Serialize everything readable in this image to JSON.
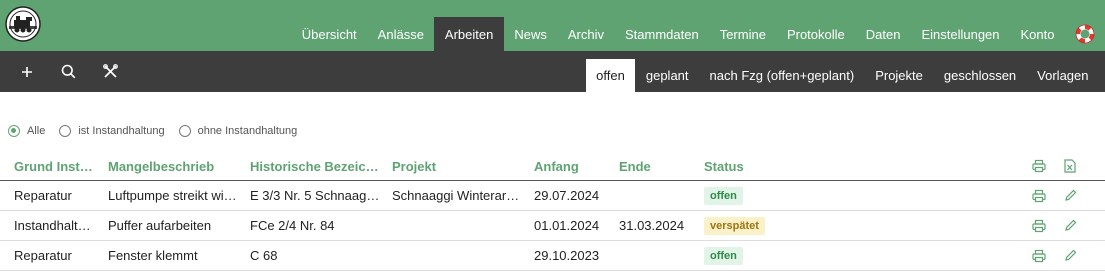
{
  "nav": {
    "items": [
      "Übersicht",
      "Anlässe",
      "Arbeiten",
      "News",
      "Archiv",
      "Stammdaten",
      "Termine",
      "Protokolle",
      "Daten",
      "Einstellungen",
      "Konto"
    ],
    "active": "Arbeiten"
  },
  "subtabs": {
    "items": [
      "offen",
      "geplant",
      "nach Fzg (offen+geplant)",
      "Projekte",
      "geschlossen",
      "Vorlagen"
    ],
    "active": "offen"
  },
  "filters": {
    "options": [
      "Alle",
      "ist Instandhaltung",
      "ohne Instandhaltung"
    ],
    "selected": "Alle"
  },
  "table": {
    "headers": [
      "Grund Inst…",
      "Mangelbeschrieb",
      "Historische Bezeic…",
      "Projekt",
      "Anfang",
      "Ende",
      "Status"
    ],
    "rows": [
      {
        "grund": "Reparatur",
        "mangel": "Luftpumpe streikt wi…",
        "bez": "E 3/3 Nr. 5 Schnaag…",
        "projekt": "Schnaaggi Winterar…",
        "anfang": "29.07.2024",
        "ende": "",
        "status": "offen"
      },
      {
        "grund": "Instandhalt…",
        "mangel": "Puffer aufarbeiten",
        "bez": "FCe 2/4 Nr. 84",
        "projekt": "",
        "anfang": "01.01.2024",
        "ende": "31.03.2024",
        "status": "verspätet"
      },
      {
        "grund": "Reparatur",
        "mangel": "Fenster klemmt",
        "bez": "C 68",
        "projekt": "",
        "anfang": "29.10.2023",
        "ende": "",
        "status": "offen"
      }
    ]
  },
  "colors": {
    "brand_green": "#5fa373",
    "toolbar_dark": "#3d3d3d",
    "status_offen": "#2f8a4a",
    "status_verspaetet": "#9a7612"
  },
  "icons": {
    "toolbar": [
      "plus-icon",
      "search-icon",
      "tools-icon"
    ],
    "header_actions": [
      "print-icon",
      "excel-icon"
    ],
    "row_actions": [
      "print-icon",
      "edit-icon"
    ],
    "help": "lifebuoy-icon"
  }
}
